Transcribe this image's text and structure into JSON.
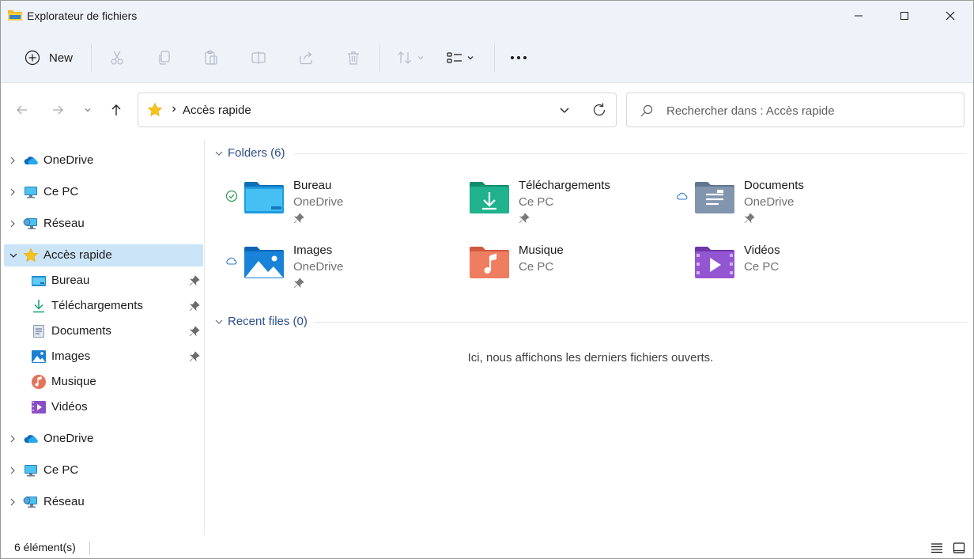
{
  "window": {
    "title": "Explorateur de fichiers"
  },
  "toolbar": {
    "new_label": "New",
    "buttons": [
      "cut-icon",
      "copy-icon",
      "paste-icon",
      "rename-icon",
      "share-icon",
      "delete-icon",
      "sort-icon",
      "view-icon",
      "more-icon"
    ]
  },
  "address": {
    "path": "Accès rapide",
    "search_placeholder": "Rechercher dans : Accès rapide"
  },
  "sidebar": {
    "top": [
      {
        "label": "OneDrive",
        "icon": "onedrive-cloud-icon"
      },
      {
        "label": "Ce PC",
        "icon": "monitor-icon"
      },
      {
        "label": "Réseau",
        "icon": "network-icon"
      }
    ],
    "quick_access": {
      "label": "Accès rapide",
      "items": [
        {
          "label": "Bureau",
          "pinned": true
        },
        {
          "label": "Téléchargements",
          "pinned": true
        },
        {
          "label": "Documents",
          "pinned": true
        },
        {
          "label": "Images",
          "pinned": true
        },
        {
          "label": "Musique",
          "pinned": false
        },
        {
          "label": "Vidéos",
          "pinned": false
        }
      ]
    },
    "bottom": [
      {
        "label": "OneDrive",
        "icon": "onedrive-cloud-icon"
      },
      {
        "label": "Ce PC",
        "icon": "monitor-icon"
      },
      {
        "label": "Réseau",
        "icon": "network-icon"
      }
    ]
  },
  "main": {
    "folders_header": "Folders (6)",
    "folders": [
      {
        "name": "Bureau",
        "location": "OneDrive",
        "status": "synced",
        "pinned": true
      },
      {
        "name": "Téléchargements",
        "location": "Ce PC",
        "status": "",
        "pinned": true
      },
      {
        "name": "Documents",
        "location": "OneDrive",
        "status": "cloud",
        "pinned": true
      },
      {
        "name": "Images",
        "location": "OneDrive",
        "status": "cloud",
        "pinned": true
      },
      {
        "name": "Musique",
        "location": "Ce PC",
        "status": "",
        "pinned": false
      },
      {
        "name": "Vidéos",
        "location": "Ce PC",
        "status": "",
        "pinned": false
      }
    ],
    "recent_header": "Recent files (0)",
    "recent_empty": "Ici, nous affichons les derniers fichiers ouverts."
  },
  "status": {
    "item_count": "6 élément(s)"
  },
  "colors": {
    "accent": "#0067c0",
    "chrome": "#eef2f9",
    "selected": "#cce4f7",
    "section_title": "#2b4f8a"
  }
}
